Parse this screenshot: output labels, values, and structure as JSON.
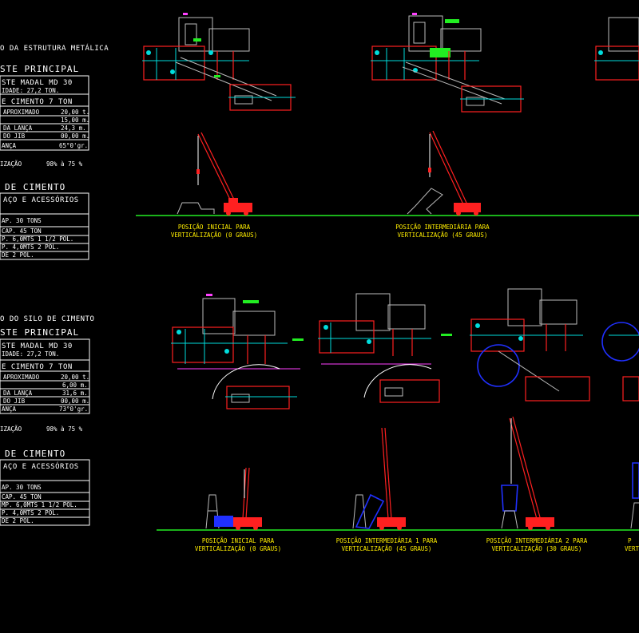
{
  "top_section": {
    "title": "O DA ESTRUTURA METÁLICA",
    "subtitle": "STE PRINCIPAL",
    "table1": [
      "STE MADAL MD 30",
      "IDADE: 27,2 TON.",
      "E CIMENTO 7 TON",
      [
        "APROXIMADO",
        "20,00 t."
      ],
      [
        "",
        "15,00 m."
      ],
      [
        "DA LANÇA",
        "24,3 m."
      ],
      [
        "DO JIB",
        "00,00 m."
      ],
      [
        "ANÇA",
        "65°0'gr."
      ]
    ],
    "util": "IZAÇÃO",
    "util_value": "98% à 75 %",
    "section2": "DE CIMENTO",
    "table2_header": "AÇO E ACESSÓRIOS",
    "table2": [
      "",
      "AP. 30 TONS",
      "CAP. 45 TON",
      "P. 6,0MTS 1 1/2 POL.",
      "P. 4,0MTS 2 POL.",
      "DE 2 POL."
    ],
    "captions": [
      [
        "POSIÇÃO INICIAL PARA",
        "VERTICALIZAÇÃO (0 GRAUS)"
      ],
      [
        "POSIÇÃO INTERMEDIÁRIA PARA",
        "VERTICALIZAÇÃO (45 GRAUS)"
      ]
    ]
  },
  "bottom_section": {
    "title": "O DO SILO DE CIMENTO",
    "subtitle": "STE PRINCIPAL",
    "table1": [
      "STE MADAL MD 30",
      "IDADE: 27,2 TON.",
      "E CIMENTO 7 TON",
      [
        "APROXIMADO",
        "20,00 t."
      ],
      [
        "",
        "6,00 m."
      ],
      [
        "DA LANÇA",
        "31,6 m."
      ],
      [
        "DO JIB",
        "00,00 m."
      ],
      [
        "ANÇA",
        "73°0'gr."
      ]
    ],
    "util": "IZAÇÃO",
    "util_value": "98% à 75 %",
    "section2": "DE CIMENTO",
    "table2_header": "AÇO E ACESSÓRIOS",
    "table2": [
      "",
      "AP. 30 TONS",
      "CAP. 45 TON",
      "MP. 6,0MTS 1 1/2 POL.",
      "P. 4,0MTS 2 POL.",
      "DE 2 POL."
    ],
    "captions": [
      [
        "POSIÇÃO INICIAL PARA",
        "VERTICALIZAÇÃO (0 GRAUS)"
      ],
      [
        "POSIÇÃO INTERMEDIÁRIA 1 PARA",
        "VERTICALIZAÇÃO (45 GRAUS)"
      ],
      [
        "POSIÇÃO INTERMEDIÁRIA 2 PARA",
        "VERTICALIZAÇÃO (30 GRAUS)"
      ],
      [
        "P",
        "VERT"
      ]
    ]
  },
  "colors": {
    "background": "#000000",
    "ground": "#22ee22",
    "crane": "#ff2020",
    "silo": "#2030ff",
    "caption": "#ffee00"
  }
}
